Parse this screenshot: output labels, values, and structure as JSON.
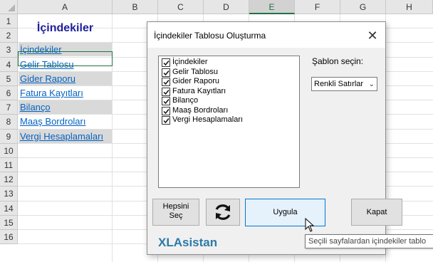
{
  "sheet": {
    "columns": [
      "A",
      "B",
      "C",
      "D",
      "E",
      "F",
      "G",
      "H"
    ],
    "selected_column": "E",
    "rows": [
      "1",
      "2",
      "3",
      "4",
      "5",
      "6",
      "7",
      "8",
      "9",
      "10",
      "11",
      "12",
      "13",
      "14",
      "15",
      "16"
    ],
    "title": "İçindekiler",
    "links": [
      {
        "text": "İçindekiler",
        "shaded": true
      },
      {
        "text": "Gelir Tablosu",
        "shaded": false
      },
      {
        "text": "Gider Raporu",
        "shaded": true
      },
      {
        "text": "Fatura Kayıtları",
        "shaded": false
      },
      {
        "text": "Bilanço",
        "shaded": true
      },
      {
        "text": "Maaş Bordroları",
        "shaded": false
      },
      {
        "text": "Vergi Hesaplamaları",
        "shaded": true
      }
    ],
    "link_color": "#0563c1",
    "title_color": "#1f1f9c"
  },
  "dialog": {
    "title": "İçindekiler Tablosu Oluşturma",
    "close_icon": "close-icon",
    "sheets": [
      {
        "label": "İçindekiler",
        "checked": true
      },
      {
        "label": "Gelir Tablosu",
        "checked": true
      },
      {
        "label": "Gider Raporu",
        "checked": true
      },
      {
        "label": "Fatura Kayıtları",
        "checked": true
      },
      {
        "label": "Bilanço",
        "checked": true
      },
      {
        "label": "Maaş Bordroları",
        "checked": true
      },
      {
        "label": "Vergi Hesaplamaları",
        "checked": true
      }
    ],
    "template_label": "Şablon seçin:",
    "template_value": "Renkli Satırlar",
    "select_all_line1": "Hepsini",
    "select_all_line2": "Seç",
    "refresh_icon": "refresh-icon",
    "apply_label": "Uygula",
    "close_label": "Kapat",
    "brand": "XLAsistan",
    "tooltip": "Seçili sayfalardan içindekiler tablo"
  }
}
